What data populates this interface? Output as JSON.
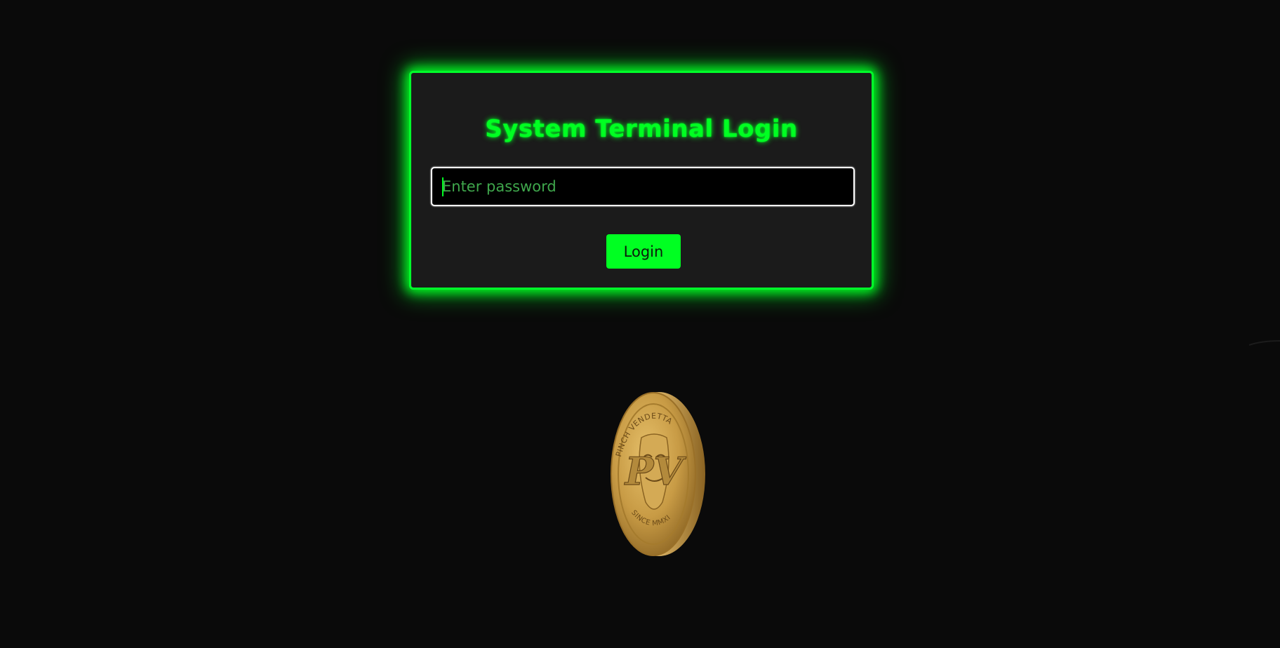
{
  "login": {
    "title": "System Terminal Login",
    "password_placeholder": "Enter password",
    "password_value": "",
    "login_button_label": "Login"
  },
  "coin": {
    "top_text": "PINCH VENDETTA",
    "monogram": "PV",
    "bottom_text": "SINCE MMXI"
  },
  "colors": {
    "background": "#0a0a0a",
    "panel": "#1b1b1b",
    "accent_green": "#00ff22",
    "coin_gold": "#c9a042"
  }
}
